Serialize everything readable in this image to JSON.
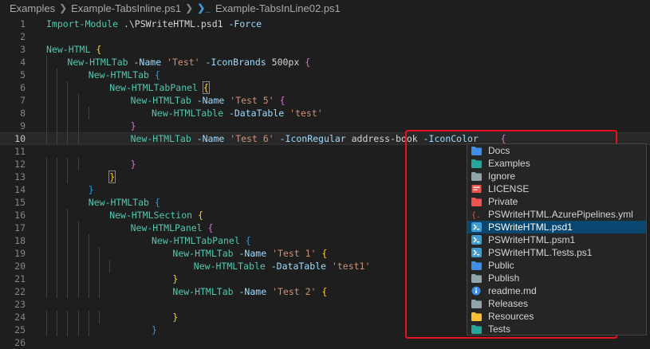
{
  "breadcrumb": {
    "items": [
      "Examples",
      "Example-TabsInline.ps1",
      "Example-TabsInLine02.ps1"
    ]
  },
  "editor": {
    "lines": [
      {
        "n": "1",
        "tokens": [
          [
            "cmd",
            "Import-Module"
          ],
          [
            "text",
            " .\\PSWriteHTML.psd1 "
          ],
          [
            "param",
            "-Force"
          ]
        ]
      },
      {
        "n": "2",
        "tokens": []
      },
      {
        "n": "3",
        "tokens": [
          [
            "cmd",
            "New-HTML"
          ],
          [
            "text",
            " "
          ],
          [
            "brace1",
            "{"
          ]
        ]
      },
      {
        "n": "4",
        "tokens": [
          [
            "cmd",
            "New-HTMLTab"
          ],
          [
            "text",
            " "
          ],
          [
            "param",
            "-Name"
          ],
          [
            "text",
            " "
          ],
          [
            "str",
            "'Test'"
          ],
          [
            "text",
            " "
          ],
          [
            "param",
            "-IconBrands"
          ],
          [
            "text",
            " 500px "
          ],
          [
            "brace2",
            "{"
          ]
        ]
      },
      {
        "n": "5",
        "tokens": [
          [
            "cmd",
            "New-HTMLTab"
          ],
          [
            "text",
            " "
          ],
          [
            "brace3",
            "{"
          ]
        ]
      },
      {
        "n": "6",
        "tokens": [
          [
            "cmd",
            "New-HTMLTabPanel"
          ],
          [
            "text",
            " "
          ],
          [
            "brace1m",
            "{"
          ]
        ]
      },
      {
        "n": "7",
        "tokens": [
          [
            "cmd",
            "New-HTMLTab"
          ],
          [
            "text",
            " "
          ],
          [
            "param",
            "-Name"
          ],
          [
            "text",
            " "
          ],
          [
            "str",
            "'Test 5'"
          ],
          [
            "text",
            " "
          ],
          [
            "brace2",
            "{"
          ]
        ]
      },
      {
        "n": "8",
        "tokens": [
          [
            "cmd",
            "New-HTMLTable"
          ],
          [
            "text",
            " "
          ],
          [
            "param",
            "-DataTable"
          ],
          [
            "text",
            " "
          ],
          [
            "str",
            "'test'"
          ]
        ]
      },
      {
        "n": "9",
        "tokens": [
          [
            "brace2",
            "}"
          ]
        ]
      },
      {
        "n": "10",
        "tokens": [
          [
            "cmd",
            "New-HTMLTab"
          ],
          [
            "text",
            " "
          ],
          [
            "param",
            "-Name"
          ],
          [
            "text",
            " "
          ],
          [
            "str",
            "'Test 6'"
          ],
          [
            "text",
            " "
          ],
          [
            "param",
            "-IconRegular"
          ],
          [
            "text",
            " address-book "
          ],
          [
            "param",
            "-IconColor"
          ],
          [
            "text",
            "    "
          ],
          [
            "brace2",
            "{"
          ]
        ]
      },
      {
        "n": "11",
        "tokens": []
      },
      {
        "n": "12",
        "tokens": [
          [
            "brace2",
            "}"
          ]
        ]
      },
      {
        "n": "13",
        "tokens": [
          [
            "brace1m",
            "}"
          ]
        ]
      },
      {
        "n": "14",
        "tokens": [
          [
            "brace3",
            "}"
          ]
        ]
      },
      {
        "n": "15",
        "tokens": [
          [
            "cmd",
            "New-HTMLTab"
          ],
          [
            "text",
            " "
          ],
          [
            "brace3",
            "{"
          ]
        ]
      },
      {
        "n": "16",
        "tokens": [
          [
            "cmd",
            "New-HTMLSection"
          ],
          [
            "text",
            " "
          ],
          [
            "brace1",
            "{"
          ]
        ]
      },
      {
        "n": "17",
        "tokens": [
          [
            "cmd",
            "New-HTMLPanel"
          ],
          [
            "text",
            " "
          ],
          [
            "brace2",
            "{"
          ]
        ]
      },
      {
        "n": "18",
        "tokens": [
          [
            "cmd",
            "New-HTMLTabPanel"
          ],
          [
            "text",
            " "
          ],
          [
            "brace3",
            "{"
          ]
        ]
      },
      {
        "n": "19",
        "tokens": [
          [
            "cmd",
            "New-HTMLTab"
          ],
          [
            "text",
            " "
          ],
          [
            "param",
            "-Name"
          ],
          [
            "text",
            " "
          ],
          [
            "str",
            "'Test 1'"
          ],
          [
            "text",
            " "
          ],
          [
            "brace1",
            "{"
          ]
        ]
      },
      {
        "n": "20",
        "tokens": [
          [
            "cmd",
            "New-HTMLTable"
          ],
          [
            "text",
            " "
          ],
          [
            "param",
            "-DataTable"
          ],
          [
            "text",
            " "
          ],
          [
            "str",
            "'test1'"
          ]
        ]
      },
      {
        "n": "21",
        "tokens": [
          [
            "brace1",
            "}"
          ]
        ]
      },
      {
        "n": "22",
        "tokens": [
          [
            "cmd",
            "New-HTMLTab"
          ],
          [
            "text",
            " "
          ],
          [
            "param",
            "-Name"
          ],
          [
            "text",
            " "
          ],
          [
            "str",
            "'Test 2'"
          ],
          [
            "text",
            " "
          ],
          [
            "brace1",
            "{"
          ]
        ]
      },
      {
        "n": "23",
        "tokens": []
      },
      {
        "n": "24",
        "tokens": [
          [
            "brace1",
            "}"
          ]
        ]
      },
      {
        "n": "25",
        "tokens": [
          [
            "brace3",
            "}"
          ]
        ]
      },
      {
        "n": "26",
        "tokens": []
      }
    ]
  },
  "suggest": {
    "items": [
      {
        "label": "Docs",
        "icon": "folder-docs-icon",
        "color": "#3d8ee6"
      },
      {
        "label": "Examples",
        "icon": "folder-examples-icon",
        "color": "#26a69a"
      },
      {
        "label": "Ignore",
        "icon": "folder-icon",
        "color": "#90a4ae"
      },
      {
        "label": "LICENSE",
        "icon": "license-icon",
        "color": "#ef5350"
      },
      {
        "label": "Private",
        "icon": "folder-private-icon",
        "color": "#ef5350"
      },
      {
        "label": "PSWriteHTML.AzurePipelines.yml",
        "icon": "yaml-icon",
        "color": "#ef5350"
      },
      {
        "label": "PSWriteHTML.psd1",
        "icon": "powershell-icon",
        "color": "#3d9bd6",
        "selected": true
      },
      {
        "label": "PSWriteHTML.psm1",
        "icon": "powershell-icon",
        "color": "#3d9bd6"
      },
      {
        "label": "PSWriteHTML.Tests.ps1",
        "icon": "powershell-icon",
        "color": "#3d9bd6"
      },
      {
        "label": "Public",
        "icon": "folder-public-icon",
        "color": "#3d8ee6"
      },
      {
        "label": "Publish",
        "icon": "folder-icon",
        "color": "#90a4ae"
      },
      {
        "label": "readme.md",
        "icon": "info-icon",
        "color": "#3d8ee6"
      },
      {
        "label": "Releases",
        "icon": "folder-icon",
        "color": "#90a4ae"
      },
      {
        "label": "Resources",
        "icon": "folder-resources-icon",
        "color": "#fbc02d"
      },
      {
        "label": "Tests",
        "icon": "folder-tests-icon",
        "color": "#26a69a"
      }
    ]
  }
}
